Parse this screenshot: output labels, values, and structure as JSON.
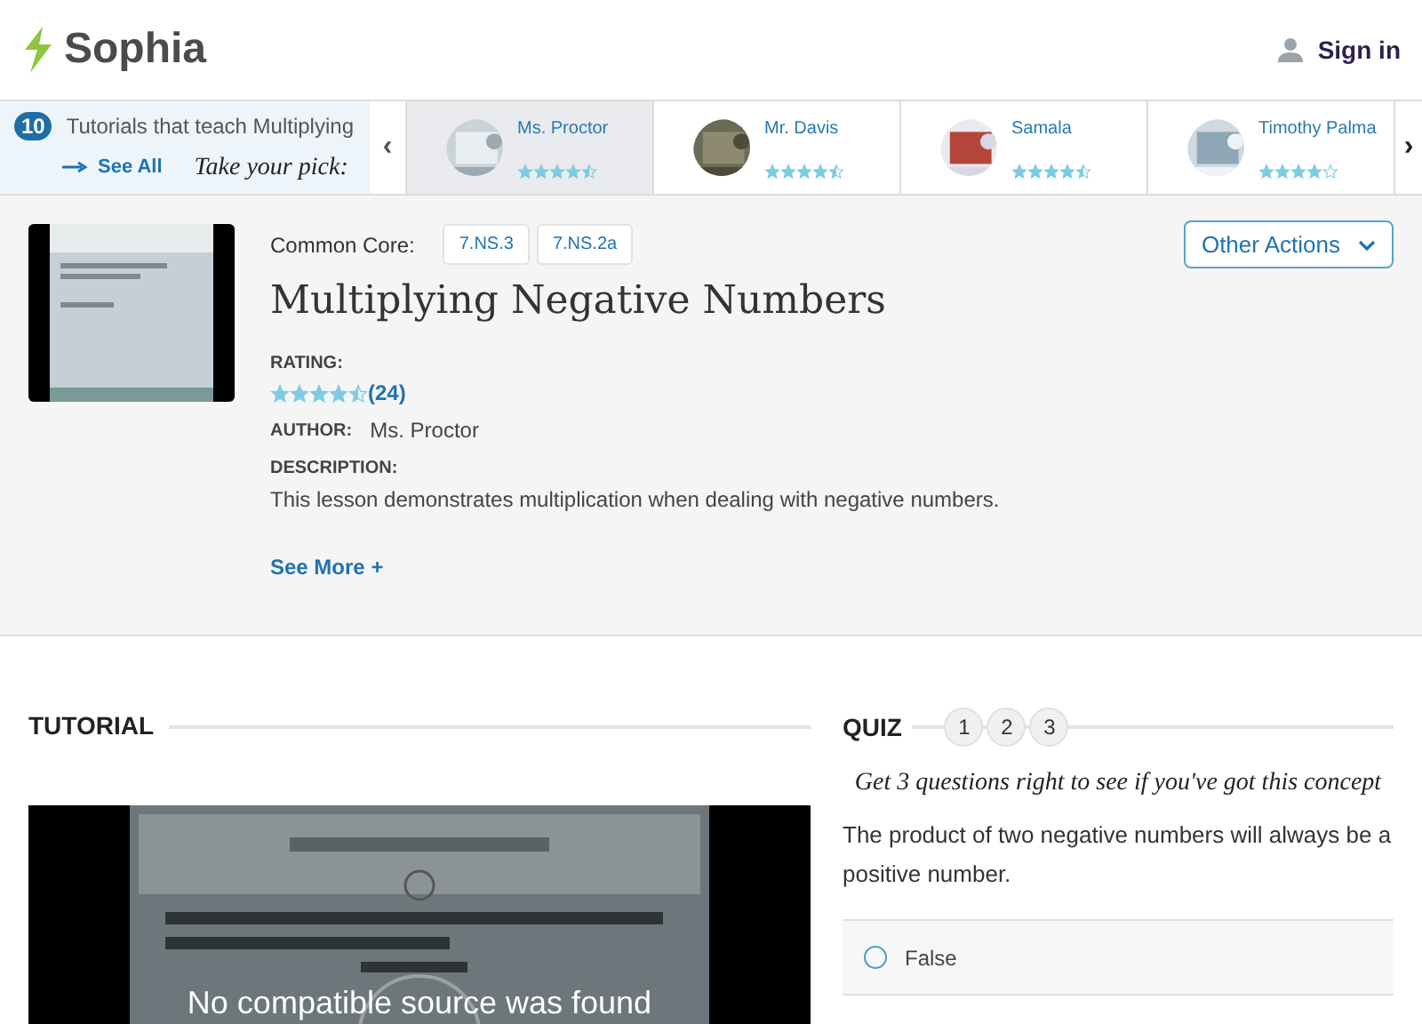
{
  "header": {
    "logo": "Sophia",
    "sign_in": "Sign in"
  },
  "carousel": {
    "count": "10",
    "title": "Tutorials that teach Multiplying",
    "see_all": "See All",
    "tagline": "Take your pick:",
    "prev": "‹",
    "next": "›",
    "cards": [
      {
        "author": "Ms. Proctor",
        "stars": 4.5,
        "selected": true
      },
      {
        "author": "Mr. Davis",
        "stars": 4.5,
        "selected": false
      },
      {
        "author": "Samala",
        "stars": 4.5,
        "selected": false
      },
      {
        "author": "Timothy Palma",
        "stars": 4,
        "selected": false
      }
    ]
  },
  "lesson": {
    "standards_label": "Common Core:",
    "standards": [
      "7.NS.3",
      "7.NS.2a"
    ],
    "title": "Multiplying Negative Numbers",
    "actions": "Other Actions",
    "rating_label": "RATING:",
    "stars": 4.5,
    "rating_count": "(24)",
    "author_label": "AUTHOR:",
    "author": "Ms. Proctor",
    "description_label": "DESCRIPTION:",
    "description": "This lesson demonstrates multiplication when dealing with negative numbers.",
    "see_more": "See More +"
  },
  "tutorial": {
    "heading": "TUTORIAL",
    "video_error": "No compatible source was found"
  },
  "quiz": {
    "heading": "QUIZ",
    "steps": [
      "1",
      "2",
      "3"
    ],
    "prompt": "Get 3 questions right to see if you've got this concept",
    "question": "The product of two negative numbers will always be a positive number.",
    "options": [
      {
        "label": "False",
        "selected": false
      }
    ]
  }
}
